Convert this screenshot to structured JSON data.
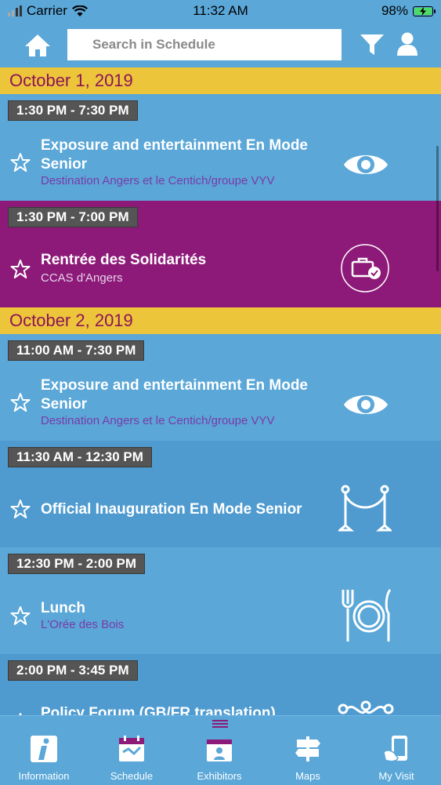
{
  "status": {
    "carrier": "Carrier",
    "time": "11:32 AM",
    "battery": "98%"
  },
  "header": {
    "search_placeholder": "Search in Schedule"
  },
  "days": [
    {
      "date": "October 1, 2019"
    },
    {
      "date": "October 2, 2019"
    }
  ],
  "events": [
    {
      "time": "1:30 PM - 7:30 PM",
      "title": "Exposure and entertainment En Mode Senior",
      "subtitle": "Destination Angers et le Centich/groupe VYV",
      "icon": "eye-icon",
      "color": "#5aa7d8"
    },
    {
      "time": "1:30 PM - 7:00 PM",
      "title": "Rentrée des Solidarités",
      "subtitle": "CCAS d'Angers",
      "icon": "briefcase-check-icon",
      "color": "#8d1a78"
    },
    {
      "time": "11:00 AM - 7:30 PM",
      "title": "Exposure and entertainment En Mode Senior",
      "subtitle": "Destination Angers et le Centich/groupe VYV",
      "icon": "eye-icon",
      "color": "#5aa7d8"
    },
    {
      "time": "11:30 AM - 12:30 PM",
      "title": "Official Inauguration En Mode Senior",
      "subtitle": "",
      "icon": "rope-barrier-icon",
      "color": "#4f9bd0"
    },
    {
      "time": "12:30 PM - 2:00 PM",
      "title": "Lunch",
      "subtitle": "L'Orée des Bois",
      "icon": "plate-cutlery-icon",
      "color": "#5aa7d8"
    },
    {
      "time": "2:00 PM - 3:45 PM",
      "title": "Policy Forum (GB/FR translation)",
      "subtitle": "",
      "icon": "network-icon",
      "color": "#4f9bd0"
    }
  ],
  "tabs": [
    {
      "label": "Information",
      "icon": "info-icon"
    },
    {
      "label": "Schedule",
      "icon": "calendar-icon"
    },
    {
      "label": "Exhibitors",
      "icon": "exhibitors-icon"
    },
    {
      "label": "Maps",
      "icon": "signpost-icon"
    },
    {
      "label": "My Visit",
      "icon": "phone-hand-icon"
    }
  ]
}
